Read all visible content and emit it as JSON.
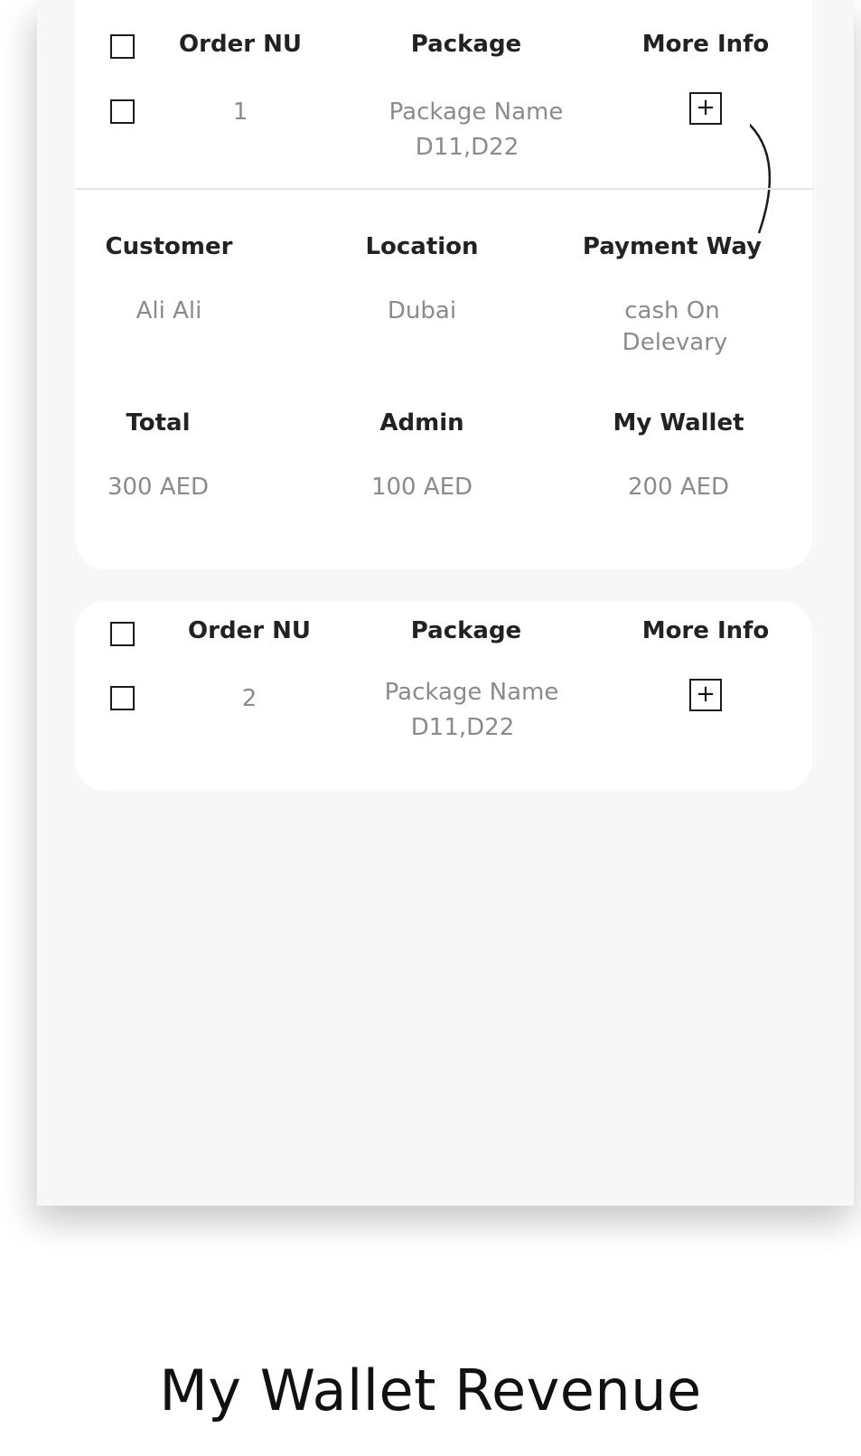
{
  "order_table": {
    "headers": {
      "order_nu": "Order NU",
      "package": "Package",
      "more_info": "More Info"
    },
    "expand_glyph": "+"
  },
  "orders": [
    {
      "number": "1",
      "package_name": "Package Name",
      "package_codes": "D11,D22",
      "expanded": true
    },
    {
      "number": "2",
      "package_name": "Package Name",
      "package_codes": "D11,D22",
      "expanded": false
    }
  ],
  "details": {
    "labels": {
      "customer": "Customer",
      "location": "Location",
      "payment_way": "Payment Way",
      "total": "Total",
      "admin": "Admin",
      "my_wallet": "My Wallet"
    },
    "values": {
      "customer": "Ali Ali",
      "location": "Dubai",
      "payment_way_line1": "cash On",
      "payment_way_line2": "Delevary",
      "total": "300 AED",
      "admin": "100 AED",
      "my_wallet": "200 AED"
    }
  },
  "caption": "My Wallet Revenue",
  "icons": [
    "checkbox-icon",
    "plus-box-icon",
    "connector-curve-icon"
  ],
  "colors": {
    "background": "#f7f7f7",
    "card": "#ffffff",
    "header_text": "#222222",
    "value_text": "#8b8b8b"
  }
}
